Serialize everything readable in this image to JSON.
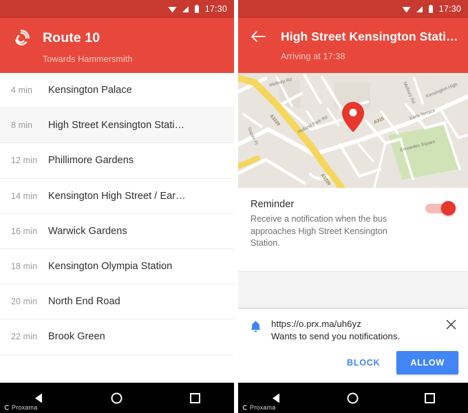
{
  "theme": {
    "primary": "#e8483b",
    "primary_dark": "#c8392f",
    "accent_blue": "#4285f4",
    "toggle_on": "#e8372c",
    "map_land": "#e9e5de",
    "map_green": "#cfe3b7",
    "map_motorway": "#f8dc6a"
  },
  "left_phone": {
    "statusbar": {
      "time": "17:30",
      "icons": [
        "wifi-icon",
        "cellular-signal-icon",
        "battery-icon"
      ]
    },
    "appbar": {
      "logo_icon": "proxama-logo-icon",
      "title": "Route 10",
      "subtitle": "Towards Hammersmith"
    },
    "stops": [
      {
        "time": "4 min",
        "name": "Kensington Palace",
        "highlighted": false
      },
      {
        "time": "8 min",
        "name": "High Street Kensington Stati…",
        "highlighted": true
      },
      {
        "time": "12 min",
        "name": "Phillimore Gardens",
        "highlighted": false
      },
      {
        "time": "14 min",
        "name": "Kensington High Street / Ear…",
        "highlighted": false
      },
      {
        "time": "16 min",
        "name": "Warwick Gardens",
        "highlighted": false
      },
      {
        "time": "18 min",
        "name": "Kensington Olympia Station",
        "highlighted": false
      },
      {
        "time": "20 min",
        "name": "North End Road",
        "highlighted": false
      },
      {
        "time": "22 min",
        "name": "Brook Green",
        "highlighted": false
      }
    ],
    "navbar": {
      "back_icon": "android-back-icon",
      "home_icon": "android-home-icon",
      "recents_icon": "android-recents-icon",
      "watermark": "Proxama"
    }
  },
  "right_phone": {
    "statusbar": {
      "time": "17:30",
      "icons": [
        "wifi-icon",
        "cellular-signal-icon",
        "battery-icon"
      ]
    },
    "appbar": {
      "back_icon": "back-arrow-icon",
      "title": "High Street Kensington Stati…",
      "subtitle": "Arriving at 17:38"
    },
    "map": {
      "marker_icon": "map-pin-icon",
      "labels": [
        "Melbury Rd",
        "A3220",
        "Holland Park Rd",
        "Napier Pl",
        "A3220",
        "Melbury Rd",
        "Kensington High",
        "A315",
        "Earls Terrace",
        "Edwardes Square"
      ]
    },
    "reminder": {
      "title": "Reminder",
      "description": "Receive a notification when the bus approaches High Street Kensington Station.",
      "toggle_state": "on"
    },
    "permission_dialog": {
      "bell_icon": "bell-icon",
      "close_icon": "close-icon",
      "url": "https://o.prx.ma/uh6yz",
      "message": "Wants to send you notifications.",
      "block_label": "BLOCK",
      "allow_label": "ALLOW"
    },
    "navbar": {
      "back_icon": "android-back-icon",
      "home_icon": "android-home-icon",
      "recents_icon": "android-recents-icon",
      "watermark": "Proxama"
    }
  }
}
